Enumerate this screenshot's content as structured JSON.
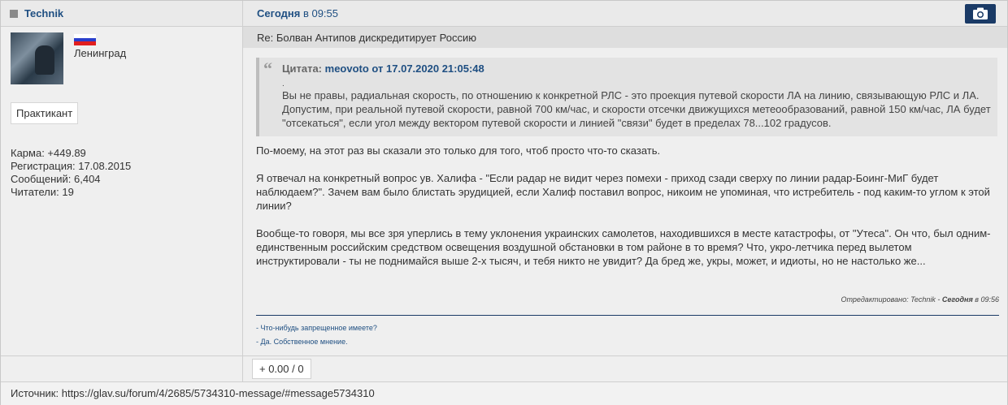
{
  "header": {
    "username": "Technik",
    "date_label": "Сегодня",
    "date_time": "в 09:55",
    "camera_icon": "camera-icon"
  },
  "user": {
    "flag_colors": [
      "#ffffff",
      "#2a3fcc",
      "#e01e1e"
    ],
    "city": "Ленинград",
    "rank": "Практикант",
    "karma": "Карма: +449.89",
    "registration": "Регистрация: 17.08.2015",
    "messages": "Сообщений: 6,404",
    "readers": "Читатели: 19"
  },
  "post": {
    "subject": "Re: Болван Антипов дискредитирует Россию",
    "quote": {
      "prefix": "Цитата:",
      "author": "meovoto от 17.07.2020 21:05:48",
      "dot": ".",
      "text": "Вы не правы, радиальная скорость, по отношению к конкретной РЛС - это проекция путевой скорости ЛА на линию, связывающую РЛС и ЛА. Допустим, при реальной путевой скорости, равной 700 км/час, и скорости отсечки движущихся метеообразований, равной 150 км/час, ЛА будет \"отсекаться\", если угол между вектором путевой скорости и линией \"связи\" будет в пределах 78...102 градусов."
    },
    "paragraphs": [
      "По-моему, на этот раз вы сказали это только для того, чтоб просто что-то сказать.",
      "Я отвечал на конкретный вопрос ув. Халифа - \"Если радар не видит через помехи - приход сзади сверху по линии радар-Боинг-МиГ будет наблюдаем?\". Зачем вам было блистать эрудицией, если Халиф поставил вопрос, никоим не упоминая, что истребитель - под каким-то углом к этой линии?",
      "Вообще-то говоря, мы все зря уперлись в тему уклонения украинских самолетов, находившихся в месте катастрофы, от \"Утеса\". Он что, был одним-единственным российским средством освещения воздушной обстановки в том районе в то время? Что, укро-летчика перед вылетом инструктировали - ты не поднимайся выше 2-х тысяч, и тебя никто не увидит? Да бред же, укры, может, и идиоты, но не настолько же..."
    ],
    "edited_prefix": "Отредактировано: Technik -",
    "edited_day": "Сегодня",
    "edited_time": "в 09:56",
    "signature": [
      "- Что-нибудь запрещенное имеете?",
      "- Да. Собственное мнение."
    ]
  },
  "footer": {
    "rating": "+ 0.00 / 0",
    "source": "Источник: https://glav.su/forum/4/2685/5734310-message/#message5734310"
  }
}
